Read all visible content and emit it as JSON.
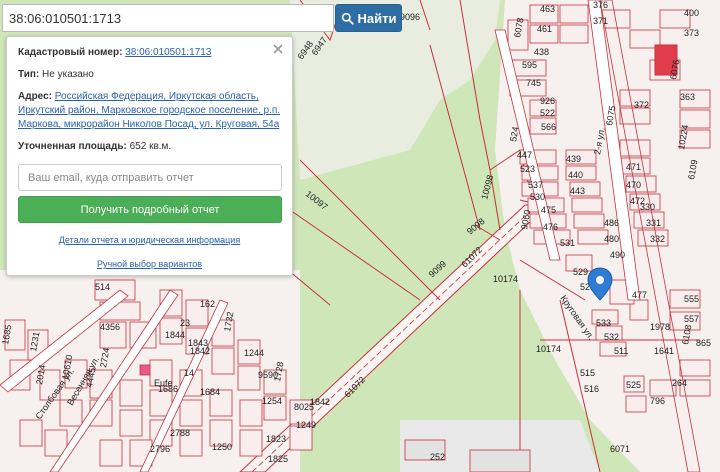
{
  "search": {
    "value": "38:06:010501:1713",
    "button_label": "Найти"
  },
  "info": {
    "cadastral_label": "Кадастровый номер:",
    "cadastral_value": "38:06:010501:1713",
    "type_label": "Тип:",
    "type_value": "Не указано",
    "address_label": "Адрес:",
    "address_line1": "Российская Федерация, Иркутская область,",
    "address_line2": "Иркутский район, Марковское городское поселение, р.п.",
    "address_line3": "Маркова, микрорайон Николов Посад, ул. Круговая, 54а",
    "area_label": "Уточненная площадь:",
    "area_value": "652 кв.м.",
    "email_placeholder": "Ваш email, куда отправить отчет",
    "report_button": "Получить подробный отчет",
    "details_link": "Детали отчета и юридическая информация",
    "manual_link": "Ручной выбор вариантов"
  },
  "map": {
    "labels": {
      "l6947": "6947",
      "l6948": "6948",
      "l10097": "10097",
      "l10098": "10098",
      "l9098": "9098",
      "l9099": "9099",
      "l61072a": "61072",
      "l61072b": "61072",
      "l10174a": "10174",
      "l10174b": "10174",
      "l528": "528",
      "l533": "533",
      "l477": "477",
      "l486": "486",
      "l480": "480",
      "l490": "490",
      "l529": "529",
      "l531": "531",
      "l475": "475",
      "l476": "476",
      "l439": "439",
      "l440": "440",
      "l443": "443",
      "l447": "447",
      "l523": "523",
      "l524": "524",
      "l537": "537",
      "l530": "530",
      "l463": "463",
      "l461": "461",
      "l438": "438",
      "l595": "595",
      "l745": "745",
      "l926": "926",
      "l522": "522",
      "l566": "566",
      "l372": "372",
      "l363": "363",
      "l371": "371",
      "l376": "376",
      "l400": "400",
      "l373": "373",
      "l330": "330",
      "l331": "331",
      "l332": "332",
      "l470": "470",
      "l471": "471",
      "l472": "472",
      "l555": "555",
      "l557": "557",
      "l525": "525",
      "l264": "264",
      "l796": "796",
      "l865": "865",
      "l1978": "1978",
      "l1641": "1641",
      "l511": "511",
      "l532": "532",
      "l514": "514",
      "l4356": "4356",
      "l1685": "1685",
      "l1231": "1231",
      "l2014": "2014",
      "l4445": "4445",
      "l2724": "2724",
      "l10610": "10610",
      "l1844": "1844",
      "l1843": "1843",
      "l1842": "1842",
      "l1732": "1732",
      "l1244": "1244",
      "l1728": "1728",
      "l1254": "1254",
      "l8025": "8025",
      "l9590": "9590",
      "l1249": "1249",
      "l1823": "1823",
      "l1825": "1825",
      "l2788": "2788",
      "l2796": "2796",
      "l1250": "1250",
      "l1842b": "1842",
      "l162": "162",
      "l23": "23",
      "l14": "14",
      "l1684": "1684",
      "l1686": "1686",
      "l9096": "9096",
      "l6071": "6071",
      "l6075": "6075",
      "l6076": "6076",
      "l6108": "6108",
      "l6109": "6109",
      "l10224": "10224",
      "l9060": "9060",
      "l6078": "6078",
      "l252": "252",
      "l515": "515",
      "l516": "516",
      "l524b": "524",
      "street_krugovaya": "Круговая ул.",
      "street_2ya": "2-я ул.",
      "street_stolbovaya": "Столбовая ул.",
      "street_vesennyaya": "Весенняя ул.",
      "street_eufe": "Eufe"
    }
  },
  "colors": {
    "map_green": "#cfe6b8",
    "boundary_red": "#c9303d",
    "parcel_fill": "#f3ebe6",
    "road": "#ffffff",
    "search_button": "#2e6da4",
    "report_button": "#4cae57",
    "marker": "#2e7cd6"
  },
  "icons": {
    "search": "search-icon",
    "close": "close-icon",
    "marker": "map-marker-icon"
  }
}
